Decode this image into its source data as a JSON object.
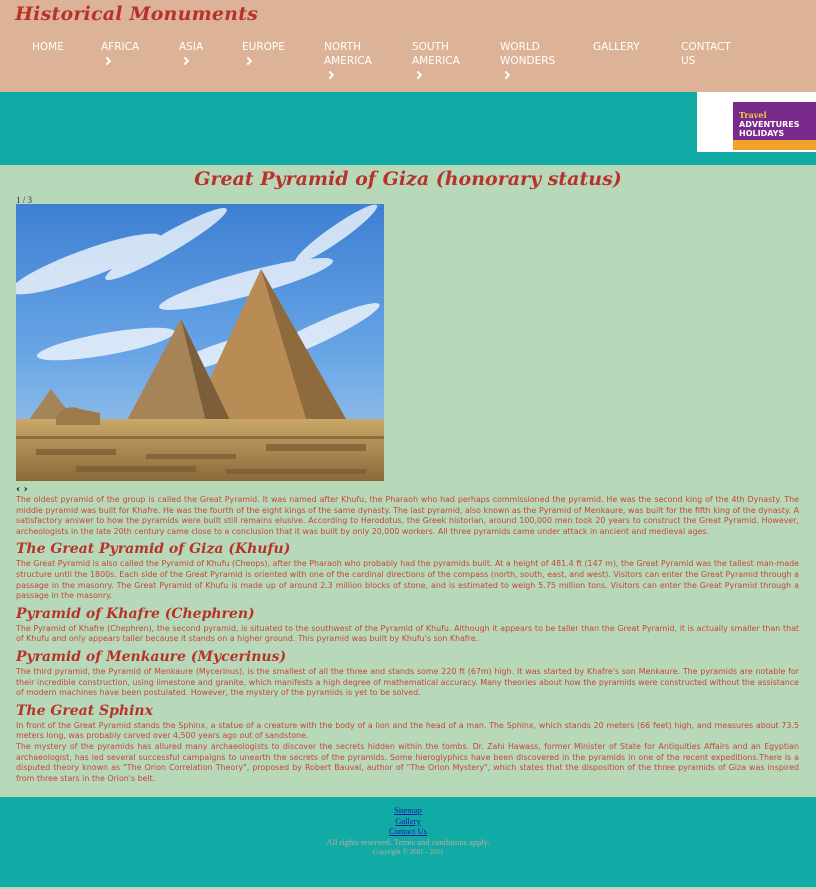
{
  "site": {
    "title": "Historical Monuments"
  },
  "nav": {
    "items": [
      {
        "label": "HOME",
        "has_submenu": false
      },
      {
        "label": "AFRICA",
        "has_submenu": true
      },
      {
        "label": "ASIA",
        "has_submenu": true
      },
      {
        "label": "EUROPE",
        "has_submenu": true
      },
      {
        "label": "NORTH AMERICA",
        "has_submenu": true
      },
      {
        "label": "SOUTH AMERICA",
        "has_submenu": true
      },
      {
        "label": "WORLD WONDERS",
        "has_submenu": true
      },
      {
        "label": "GALLERY",
        "has_submenu": false
      },
      {
        "label": "CONTACT US",
        "has_submenu": false
      }
    ]
  },
  "ad": {
    "line1": "Travel",
    "line2": "ADVENTURES",
    "line3": "HOLIDAYS"
  },
  "page": {
    "heading": "Great Pyramid of Giza (honorary status)",
    "slider": {
      "counter": "1 / 3",
      "prev": "‹",
      "next": "›"
    },
    "intro": "The oldest pyramid of the group is called the Great Pyramid. It was named after Khufu, the Pharaoh who had perhaps commissioned the pyramid. He was the second king of the 4th Dynasty. The middle pyramid was built for Khafre. He was the fourth of the eight kings of the same dynasty. The last pyramid, also known as the Pyramid of Menkaure, was built for the fifth king of the dynasty. A satisfactory answer to how the pyramids were built still remains elusive. According to Herodotus, the Greek historian, around 100,000 men took 20 years to construct the Great Pyramid. However, archeologists in the late 20th century came close to a conclusion that it was built by only 20,000 workers. All three pyramids came under attack in ancient and medieval ages.",
    "sections": [
      {
        "heading": "The Great Pyramid of Giza (Khufu)",
        "paragraphs": [
          "The Great Pyramid is also called the Pyramid of Khufu (Cheops), after the Pharaoh who probably had the pyramids built. At a height of 481.4 ft (147 m), the Great Pyramid was the tallest man-made structure until the 1800s. Each side of the Great Pyramid is oriented with one of the cardinal directions of the compass (north, south, east, and west). Visitors can enter the Great Pyramid through a passage in the masonry. The Great Pyramid of Khufu is made up of around 2.3 million blocks of stone, and is estimated to weigh 5.75 million tons. Visitors can enter the Great Pyramid through a passage in the masonry."
        ]
      },
      {
        "heading": "Pyramid of Khafre (Chephren)",
        "paragraphs": [
          "The Pyramid of Khafre (Chephren), the second pyramid, is situated to the southwest of the Pyramid of Khufu. Although it appears to be taller than the Great Pyramid, it is actually smaller than that of Khufu and only appears taller because it stands on a higher ground. This pyramid was built by Khufu's son Khafre."
        ]
      },
      {
        "heading": "Pyramid of Menkaure (Mycerinus)",
        "paragraphs": [
          "The third pyramid, the Pyramid of Menkaure (Mycerinus), is the smallest of all the three and stands some 220 ft (67m) high. It was started by Khafre's son Menkaure. The pyramids are notable for their incredible construction, using limestone and granite, which manifests a high degree of mathematical accuracy. Many theories about how the pyramids were constructed without the assistance of modern machines have been postulated. However, the mystery of the pyramids is yet to be solved."
        ]
      },
      {
        "heading": "The Great Sphinx",
        "paragraphs": [
          "In front of the Great Pyramid stands the Sphinx, a statue of a creature with the body of a lion and the head of a man. The Sphinx, which stands 20 meters (66 feet) high, and measures about 73.5 meters long, was probably carved over 4,500 years ago out of sandstone.",
          "The mystery of the pyramids has allured many archaeologists to discover the secrets hidden within the tombs. Dr. Zahi Hawass, former Minister of State for Antiquities Affairs and an Egyptian archaeologist, has led several successful campaigns to unearth the secrets of the pyramids. Some hieroglyphics have been discovered in the pyramids in one of the recent expeditions.There is a disputed theory known as \"The Orion Correlation Theory\", proposed by Robert Bauval, author of \"The Orion Mystery\", which states that the disposition of the three pyramids of Giza was inspired from three stars in the Orion's belt."
        ]
      }
    ]
  },
  "footer": {
    "links": [
      "Sitemap",
      "Gallery",
      "Contact Us"
    ],
    "rights": "All rights reserved. Terms and conditions apply.",
    "copyright": "Copyright © 2001 - 2021"
  }
}
